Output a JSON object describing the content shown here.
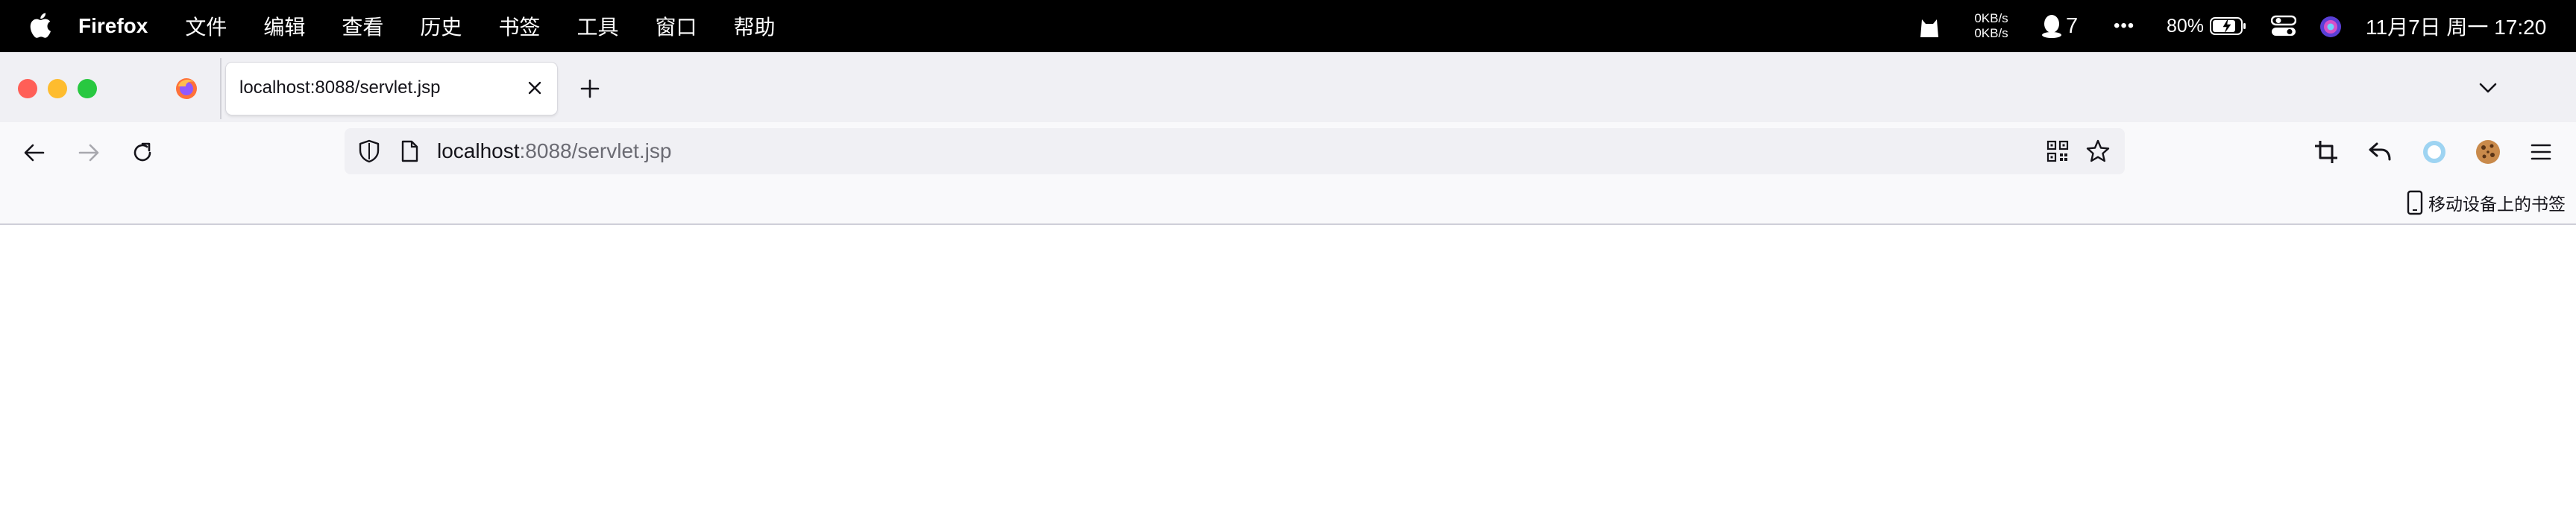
{
  "menubar": {
    "app_name": "Firefox",
    "menus": [
      "文件",
      "编辑",
      "查看",
      "历史",
      "书签",
      "工具",
      "窗口",
      "帮助"
    ],
    "status": {
      "net_up": "0KB/s",
      "net_down": "0KB/s",
      "qq_count": "7",
      "more": "•••",
      "battery": "80%",
      "datetime": "11月7日 周一  17:20"
    }
  },
  "tab": {
    "title": "localhost:8088/servlet.jsp"
  },
  "urlbar": {
    "host": "localhost",
    "rest": ":8088/servlet.jsp"
  },
  "bookmarks": {
    "mobile_label": "移动设备上的书签"
  },
  "colors": {
    "traffic_close": "#ff5f57",
    "traffic_min": "#febc2e",
    "traffic_max": "#28c840",
    "toolbar_bg": "#f9f9fb",
    "tabstrip_bg": "#f0f0f4"
  },
  "icons": [
    "apple-icon",
    "cat-icon",
    "qq-penguin-icon",
    "battery-icon",
    "control-center-icon",
    "siri-icon",
    "firefox-icon",
    "close-icon",
    "plus-icon",
    "chevron-down-icon",
    "back-icon",
    "forward-icon",
    "reload-icon",
    "shield-icon",
    "page-icon",
    "qr-code-icon",
    "star-icon",
    "crop-icon",
    "undo-icon",
    "extension-ring-icon",
    "cookie-icon",
    "hamburger-menu-icon",
    "mobile-device-icon"
  ]
}
